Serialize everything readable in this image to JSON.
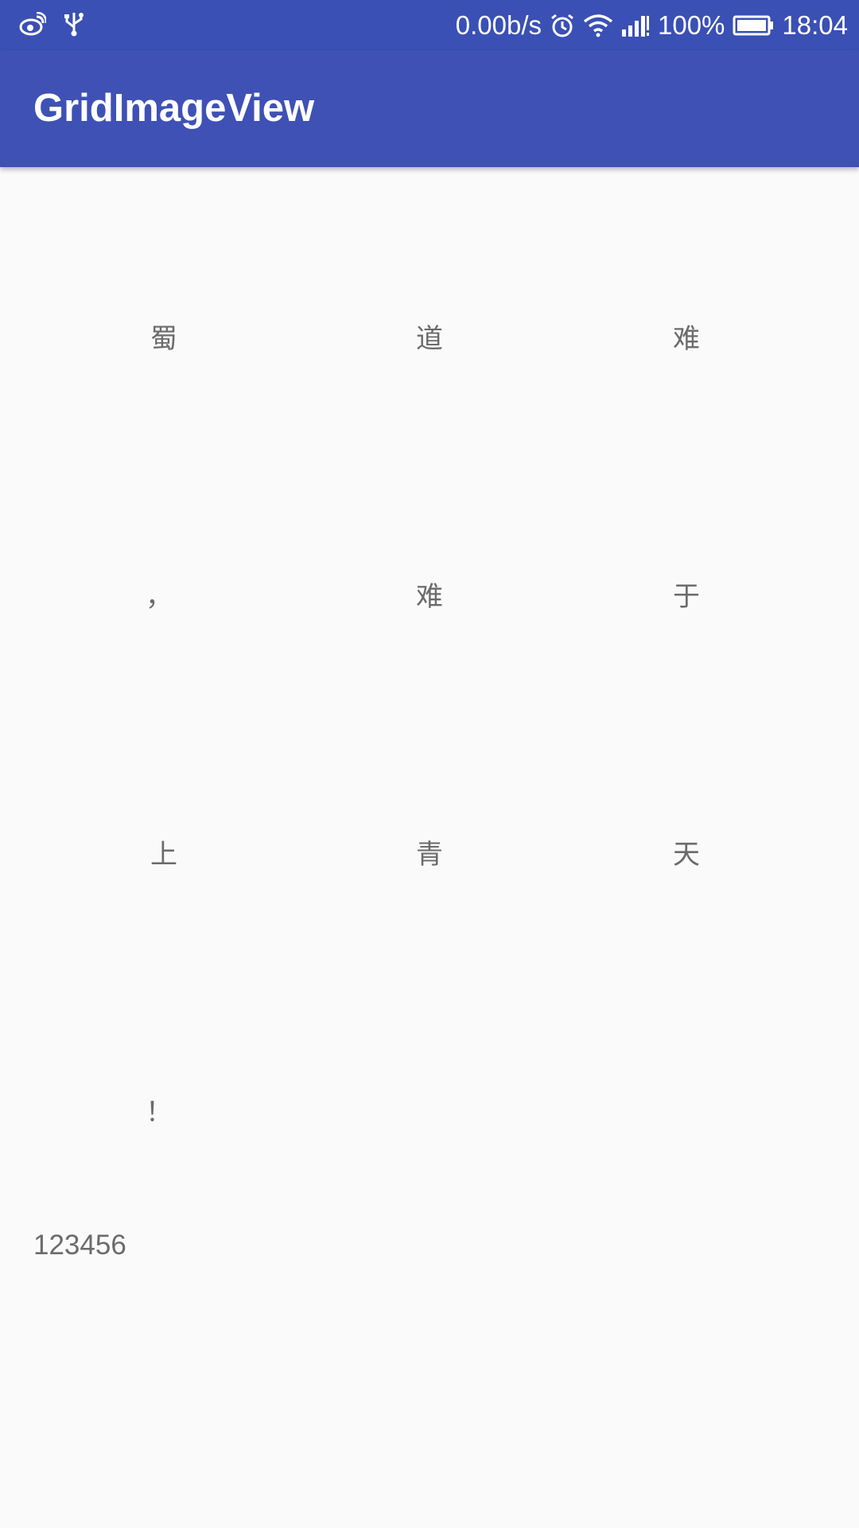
{
  "status_bar": {
    "network_speed": "0.00b/s",
    "battery": "100%",
    "time": "18:04",
    "icons_left": [
      "weibo-icon",
      "usb-icon"
    ],
    "icons_right": [
      "alarm-icon",
      "wifi-icon",
      "signal-icon",
      "battery-icon"
    ]
  },
  "app_bar": {
    "title": "GridImageView",
    "color": "#3f51b5"
  },
  "grid": {
    "cells": [
      "蜀",
      "道",
      "难",
      "，",
      "难",
      "于",
      "上",
      "青",
      "天",
      "！"
    ]
  },
  "footer": {
    "text": "123456"
  }
}
